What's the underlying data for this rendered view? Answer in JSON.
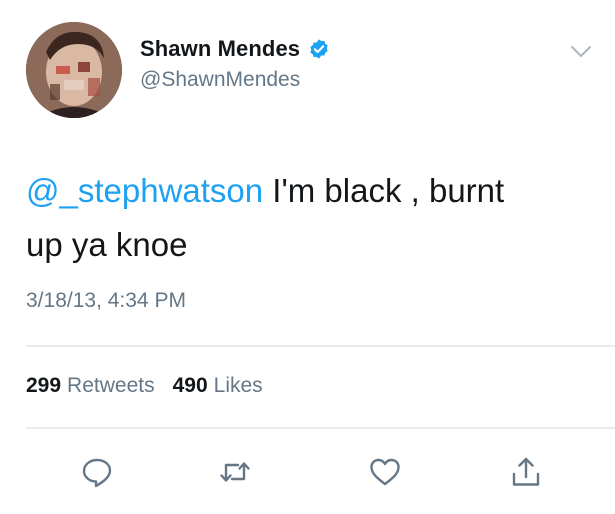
{
  "author": {
    "display_name": "Shawn Mendes",
    "handle": "@ShawnMendes",
    "verified": true
  },
  "tweet": {
    "mention": "@_stephwatson",
    "text_line1": " I'm black , burnt",
    "text_line2": "up ya knoe",
    "timestamp": "3/18/13, 4:34 PM"
  },
  "stats": {
    "retweets_count": "299",
    "retweets_label": "Retweets",
    "likes_count": "490",
    "likes_label": "Likes"
  },
  "actions": {
    "icons": [
      "reply-icon",
      "retweet-icon",
      "like-icon",
      "share-icon"
    ]
  },
  "colors": {
    "accent": "#1da1f2",
    "text": "#14171a",
    "muted": "#657786",
    "divider": "#e6ecf0"
  }
}
